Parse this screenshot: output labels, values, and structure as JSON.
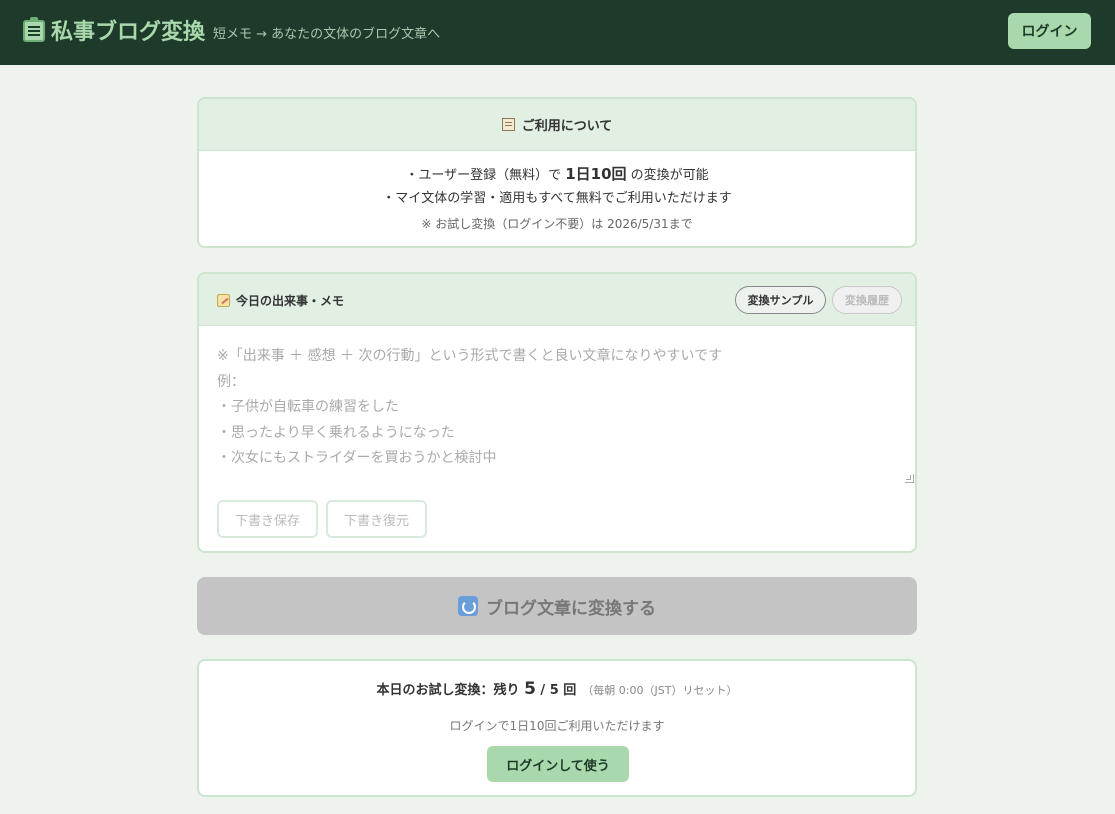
{
  "header": {
    "logo_icon": "notebook-icon",
    "title": "私事ブログ変換",
    "subtitle": "短メモ → あなたの文体のブログ文章へ",
    "login_label": "ログイン"
  },
  "info": {
    "icon": "notebook-icon",
    "title": "ご利用について",
    "line1_prefix": "・ユーザー登録（無料）で ",
    "line1_bold": "1日10回",
    "line1_suffix": " の変換が可能",
    "line2": "・マイ文体の学習・適用もすべて無料でご利用いただけます",
    "note": "※ お試し変換（ログイン不要）は 2026/5/31まで"
  },
  "memo": {
    "icon": "pencil-icon",
    "title": "今日の出来事・メモ",
    "sample_label": "変換サンプル",
    "history_label": "変換履歴",
    "placeholder": "※「出来事 ＋ 感想 ＋ 次の行動」という形式で書くと良い文章になりやすいです\n例：\n・子供が自転車の練習をした\n・思ったより早く乗れるようになった\n・次女にもストライダーを買おうかと検討中",
    "save_draft_label": "下書き保存",
    "restore_draft_label": "下書き復元"
  },
  "convert": {
    "icon": "refresh-icon",
    "label": "ブログ文章に変換する"
  },
  "trial": {
    "prefix": "本日のお試し変換：残り ",
    "remaining": "5",
    "sep": " / ",
    "total": "5",
    "unit": " 回",
    "reset_note": "（毎朝 0:00（JST）リセット）",
    "note": "ログインで1日10回ご利用いただけます",
    "login_label": "ログインして使う"
  }
}
